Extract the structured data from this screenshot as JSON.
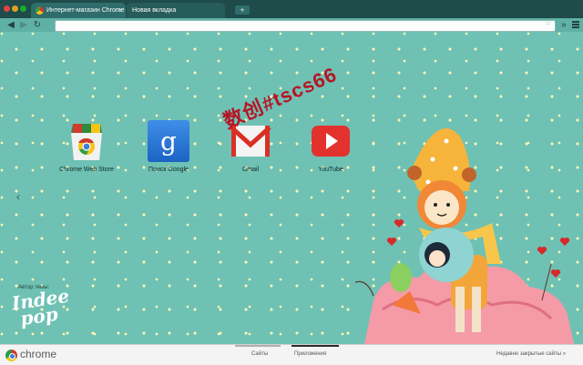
{
  "browser": {
    "tabs": [
      {
        "label": "Интернет-магазин Chrome",
        "active": true
      },
      {
        "label": "Новая вкладка",
        "active": false
      }
    ],
    "url": ""
  },
  "apps": [
    {
      "label": "Chrome Web Store",
      "icon": "chrome-web-store-icon"
    },
    {
      "label": "Поиск Google",
      "icon": "google-search-icon"
    },
    {
      "label": "Gmail",
      "icon": "gmail-icon"
    },
    {
      "label": "YouTube",
      "icon": "youtube-icon"
    }
  ],
  "theme": {
    "author_label": "Автор темы:",
    "author_logo": "Indee pop",
    "watermark": "数创#tscs66"
  },
  "footer": {
    "brand": "chrome",
    "tabs": [
      {
        "label": "Сайты",
        "active": false
      },
      {
        "label": "Приложения",
        "active": true
      }
    ],
    "recently_closed": "Недавно закрытые сайты »"
  },
  "colors": {
    "background": "#6fc1b4",
    "dots": "#fff6b8",
    "tabstrip": "#1f4b4a"
  }
}
